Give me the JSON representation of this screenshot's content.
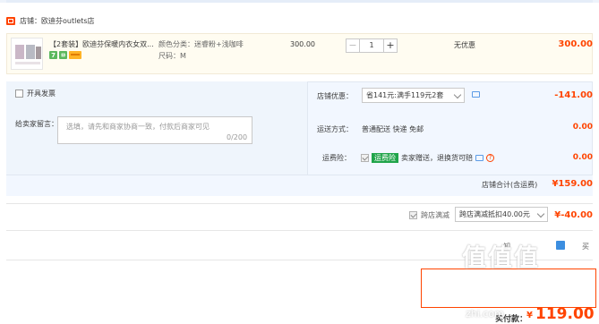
{
  "shop": {
    "label": "店铺：欧迪芬outlets店"
  },
  "item": {
    "title": "【2套装】欧迪芬保暖内衣女双...",
    "badges": [
      "7",
      "⑩"
    ],
    "color_label": "颜色分类：迷睿粉+浅咖啡",
    "size_label": "尺码：M",
    "price": "300.00",
    "qty_minus": "−",
    "qty": "1",
    "qty_plus": "+",
    "discount": "无优惠",
    "subtotal": "300.00"
  },
  "invoice": {
    "label": "开具发票"
  },
  "message": {
    "label": "给卖家留言：",
    "placeholder": "选填，请先和商家协商一致，付款后商家可见",
    "count": "0/200"
  },
  "coupon": {
    "label": "店铺优惠：",
    "selected": "省141元:满手119元2套",
    "value": "-141.00"
  },
  "shipping": {
    "label": "运送方式：",
    "text": "普通配送 快递 免邮",
    "value": "0.00"
  },
  "insurance": {
    "label": "运费险：",
    "badge": "运费险",
    "text": "卖家赠送，退换货可赔",
    "value": "0.00"
  },
  "shop_total": {
    "label": "店铺合计(含运费)",
    "value": "¥159.00"
  },
  "cross_store": {
    "label": "跨店满减",
    "selected": "跨店满减抵扣40.00元",
    "value": "¥-40.00"
  },
  "footer": {
    "anonymous_partial": "买",
    "mid_partial": "卸"
  },
  "payment": {
    "label": "实付款：",
    "currency": "¥",
    "amount": "119.00"
  },
  "watermark": {
    "main": "值值值",
    "sub": "zhi.com"
  }
}
